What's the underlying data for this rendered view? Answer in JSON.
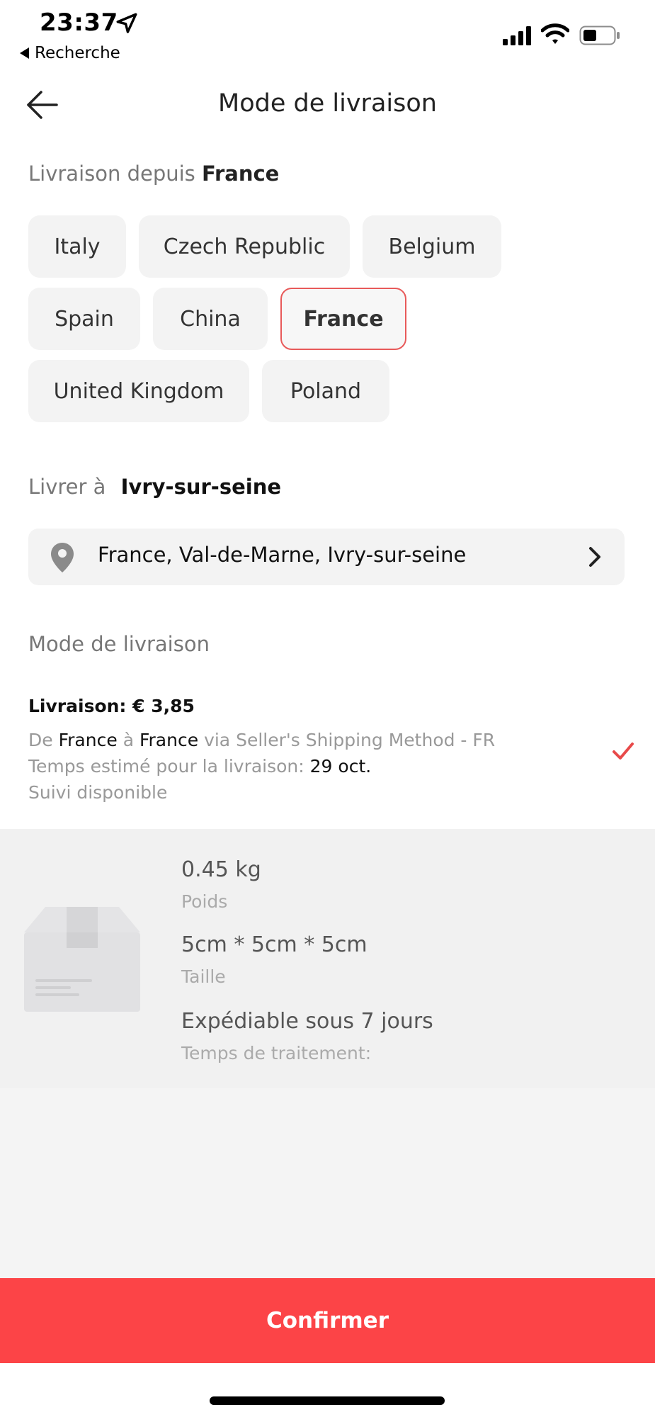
{
  "status_bar": {
    "time": "23:37",
    "back_app_label": "Recherche",
    "icons": [
      "location-arrow-icon",
      "signal-icon",
      "wifi-icon",
      "battery-icon"
    ]
  },
  "header": {
    "title": "Mode de livraison",
    "back_icon": "arrow-left-icon"
  },
  "ship_from": {
    "label": "Livraison depuis",
    "selected": "France",
    "countries": [
      "Italy",
      "Czech Republic",
      "Belgium",
      "Spain",
      "China",
      "France",
      "United Kingdom",
      "Poland"
    ]
  },
  "deliver_to": {
    "label": "Livrer à",
    "city": "Ivry-sur-seine",
    "address": "France, Val-de-Marne, Ivry-sur-seine",
    "icons": [
      "map-pin-icon",
      "chevron-right-icon"
    ]
  },
  "shipping_method": {
    "section_label": "Mode de livraison",
    "price_line": "Livraison: € 3,85",
    "from_prefix": "De",
    "from_country": "France",
    "to_word": "à",
    "to_country": "France",
    "via_text": "via Seller's Shipping Method - FR",
    "eta_label": "Temps estimé pour la livraison:",
    "eta_value": "29 oct.",
    "tracking": "Suivi disponible",
    "selected_icon": "checkmark-icon"
  },
  "package": {
    "weight_value": "0.45 kg",
    "weight_label": "Poids",
    "size_value": "5cm * 5cm * 5cm",
    "size_label": "Taille",
    "processing_value": "Expédiable sous 7 jours",
    "processing_label": "Temps de traitement:",
    "image_icon": "package-box-icon"
  },
  "footer": {
    "confirm_label": "Confirmer"
  },
  "colors": {
    "accent": "#fc4447",
    "selected_border": "#e85a5a",
    "chip_bg": "#f3f3f3",
    "muted_text": "#999999"
  }
}
